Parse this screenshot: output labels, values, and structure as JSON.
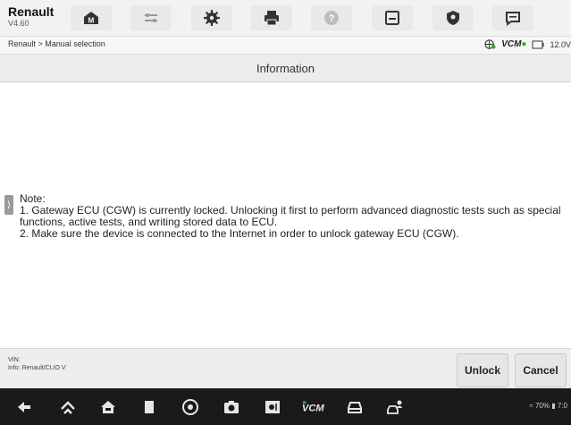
{
  "app": {
    "title": "Renault",
    "version": "V4.60"
  },
  "toolbar": {
    "buttons": [
      {
        "icon": "home-m-icon"
      },
      {
        "icon": "vehicle-swap-icon"
      },
      {
        "icon": "settings-gear-icon"
      },
      {
        "icon": "printer-icon"
      },
      {
        "icon": "help-icon"
      },
      {
        "icon": "save-icon"
      },
      {
        "icon": "shield-location-icon"
      },
      {
        "icon": "message-icon"
      }
    ]
  },
  "breadcrumb": "Renault > Manual selection",
  "status": {
    "vcm": "VCM",
    "voltage": "12.0V"
  },
  "panel": {
    "title": "Information"
  },
  "note": {
    "heading": "Note:",
    "line1": "1. Gateway ECU (CGW) is currently locked. Unlocking it first to perform advanced diagnostic tests such as special functions, active tests, and writing stored data to ECU.",
    "line2": "2. Make sure the device is connected to the Internet in order to unlock gateway ECU (CGW)."
  },
  "footer": {
    "vin_label": "VIN:",
    "info_label": "Info: Renault/CLIO V",
    "unlock_label": "Unlock",
    "cancel_label": "Cancel"
  },
  "system": {
    "battery": "70%",
    "clock": "7:0"
  },
  "colors": {
    "toolbar_bg": "#f2f2f2",
    "header_bg": "#ececec",
    "navbar_bg": "#1a1a1a",
    "accent_green": "#39a935"
  }
}
